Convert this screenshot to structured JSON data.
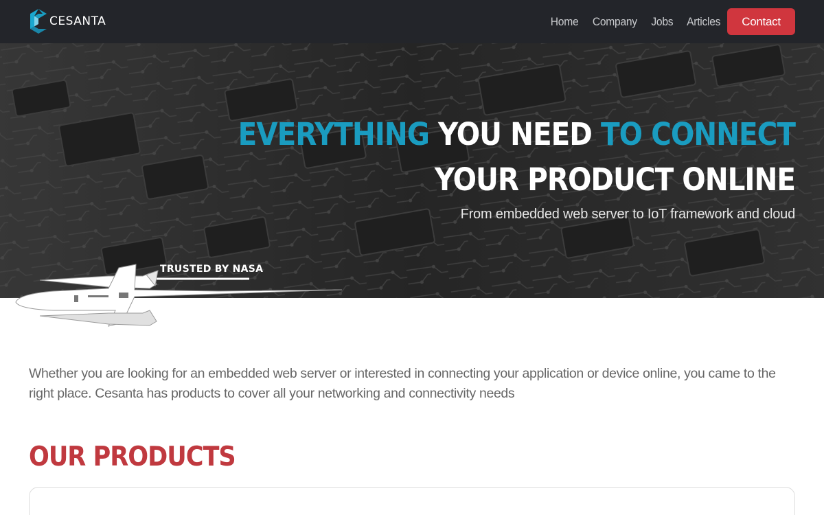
{
  "header": {
    "logo_text": "CESANTA",
    "nav": {
      "home": "Home",
      "company": "Company",
      "jobs": "Jobs",
      "articles": "Articles",
      "contact": "Contact"
    }
  },
  "hero": {
    "title_line1_part1": "EVERYTHING",
    "title_line1_part2": " YOU NEED ",
    "title_line1_part3": "TO CONNECT",
    "title_line2": "YOUR PRODUCT ONLINE",
    "subtitle": "From embedded web server to IoT framework and cloud",
    "badge": "TRUSTED BY NASA"
  },
  "main": {
    "intro": "Whether you are looking for an embedded web server or interested in connecting your application or device online, you came to the right place. Cesanta has products to cover all your networking and connectivity needs",
    "products_title": "OUR PRODUCTS"
  },
  "colors": {
    "nav_bg": "#23252a",
    "accent_blue": "#1a9cc0",
    "accent_red": "#d0363e",
    "section_red": "#c0393f"
  },
  "icons": {
    "logo": "cesanta-logo-icon",
    "shuttle": "space-shuttle-icon"
  }
}
